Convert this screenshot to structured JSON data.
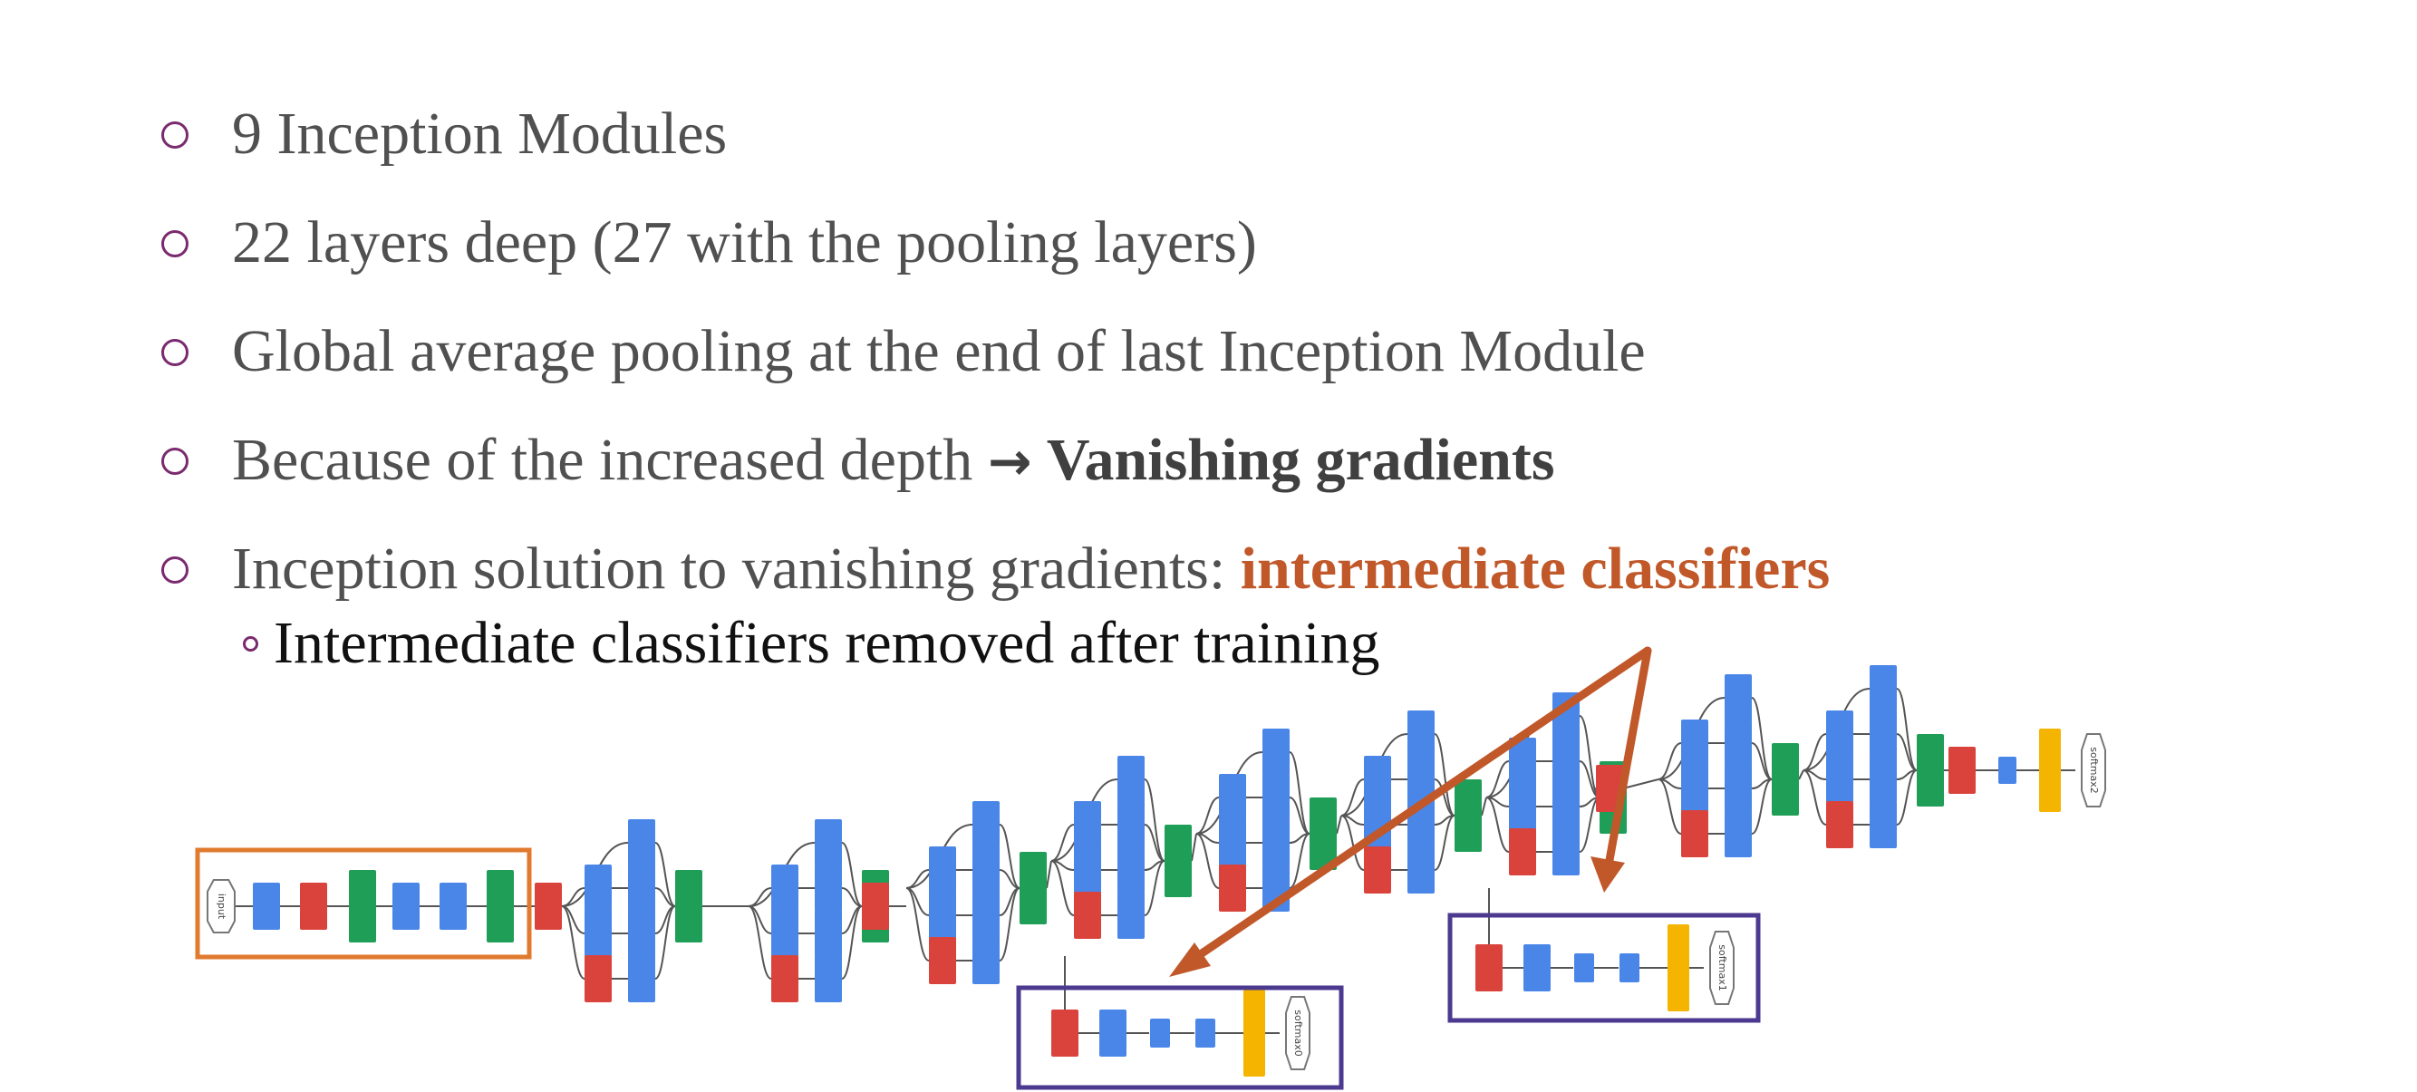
{
  "bullets": [
    {
      "text": "9 Inception Modules"
    },
    {
      "text": "22 layers deep (27 with the pooling layers)"
    },
    {
      "text": "Global average pooling at the end of last Inception Module"
    },
    {
      "text": "Because of the increased depth ",
      "arrow": "→",
      "bold": "Vanishing gradients"
    },
    {
      "text": "Inception solution to vanishing gradients: ",
      "accent": "intermediate classifiers"
    }
  ],
  "sub_bullet": "Intermediate classifiers removed after training",
  "diagram_labels": {
    "input": "input",
    "softmax0": "softmax0",
    "softmax1": "softmax1",
    "softmax2": "softmax2"
  },
  "colors": {
    "conv": "#4a86e8",
    "pool": "#d9433b",
    "concat": "#1f9e58",
    "softmax": "#f4b400",
    "stem_box": "#e07a2e",
    "aux_box": "#4b3a8f",
    "callout_arrow": "#c0582a",
    "bullet_mark": "#7a2a6e"
  }
}
